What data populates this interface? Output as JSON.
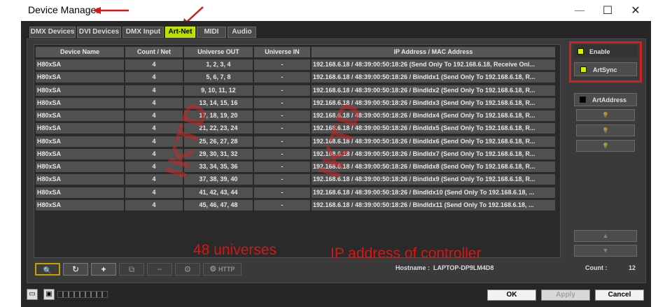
{
  "window": {
    "title": "Device Manager",
    "min_glyph": "—",
    "max_glyph": "☐",
    "close_glyph": "✕"
  },
  "tabs": [
    {
      "label": "DMX Devices",
      "active": false
    },
    {
      "label": "DVI Devices",
      "active": false
    },
    {
      "label": "DMX Input",
      "active": false
    },
    {
      "label": "Art-Net",
      "active": true
    },
    {
      "label": "MIDI",
      "active": false
    },
    {
      "label": "Audio",
      "active": false
    }
  ],
  "table": {
    "columns": [
      "Device Name",
      "Count / Net",
      "Universe OUT",
      "Universe IN",
      "IP Address / MAC Address"
    ],
    "rows": [
      [
        "H80xSA",
        "4",
        "1, 2, 3, 4",
        "-",
        "192.168.6.18 / 48:39:00:50:18:26 (Send Only To 192.168.6.18, Receive Onl..."
      ],
      [
        "H80xSA",
        "4",
        "5, 6, 7, 8",
        "-",
        "192.168.6.18 / 48:39:00:50:18:26 / BindIdx1 (Send Only To 192.168.6.18, R..."
      ],
      [
        "H80xSA",
        "4",
        "9, 10, 11, 12",
        "-",
        "192.168.6.18 / 48:39:00:50:18:26 / BindIdx2 (Send Only To 192.168.6.18, R..."
      ],
      [
        "H80xSA",
        "4",
        "13, 14, 15, 16",
        "-",
        "192.168.6.18 / 48:39:00:50:18:26 / BindIdx3 (Send Only To 192.168.6.18, R..."
      ],
      [
        "H80xSA",
        "4",
        "17, 18, 19, 20",
        "-",
        "192.168.6.18 / 48:39:00:50:18:26 / BindIdx4 (Send Only To 192.168.6.18, R..."
      ],
      [
        "H80xSA",
        "4",
        "21, 22, 23, 24",
        "-",
        "192.168.6.18 / 48:39:00:50:18:26 / BindIdx5 (Send Only To 192.168.6.18, R..."
      ],
      [
        "H80xSA",
        "4",
        "25, 26, 27, 28",
        "-",
        "192.168.6.18 / 48:39:00:50:18:26 / BindIdx6 (Send Only To 192.168.6.18, R..."
      ],
      [
        "H80xSA",
        "4",
        "29, 30, 31, 32",
        "-",
        "192.168.6.18 / 48:39:00:50:18:26 / BindIdx7 (Send Only To 192.168.6.18, R..."
      ],
      [
        "H80xSA",
        "4",
        "33, 34, 35, 36",
        "-",
        "192.168.6.18 / 48:39:00:50:18:26 / BindIdx8 (Send Only To 192.168.6.18, R..."
      ],
      [
        "H80xSA",
        "4",
        "37, 38, 39, 40",
        "-",
        "192.168.6.18 / 48:39:00:50:18:26 / BindIdx9 (Send Only To 192.168.6.18, R..."
      ],
      [
        "H80xSA",
        "4",
        "41, 42, 43, 44",
        "-",
        "192.168.6.18 / 48:39:00:50:18:26 / BindIdx10 (Send Only To 192.168.6.18, ..."
      ],
      [
        "H80xSA",
        "4",
        "45, 46, 47, 48",
        "-",
        "192.168.6.18 / 48:39:00:50:18:26 / BindIdx11 (Send Only To 192.168.6.18, ..."
      ]
    ]
  },
  "watermark": [
    "IKTD",
    "IKTD"
  ],
  "right_panel": {
    "enable_label": "Enable",
    "artsync_label": "ArtSync",
    "artaddress_label": "ArtAddress",
    "up_glyph": "▲",
    "down_glyph": "▼",
    "bulb_glyph": "💡"
  },
  "toolbar": {
    "search_glyph": "🔍",
    "refresh_glyph": "↻",
    "add_glyph": "+",
    "copy_glyph": "⧉",
    "remove_glyph": "−",
    "settings_glyph": "⚙",
    "http_label": "HTTP",
    "hostname_label": "Hostname :",
    "hostname_value": "LAPTOP-DP9LM4D8",
    "count_label": "Count :",
    "count_value": "12"
  },
  "footer": {
    "ok_label": "OK",
    "apply_label": "Apply",
    "cancel_label": "Cancel"
  },
  "annotations": {
    "universes": "48 universes",
    "ip_controller": "IP address of controller"
  },
  "colors": {
    "accent": "#b8e000",
    "annotation_red": "#d41818"
  }
}
